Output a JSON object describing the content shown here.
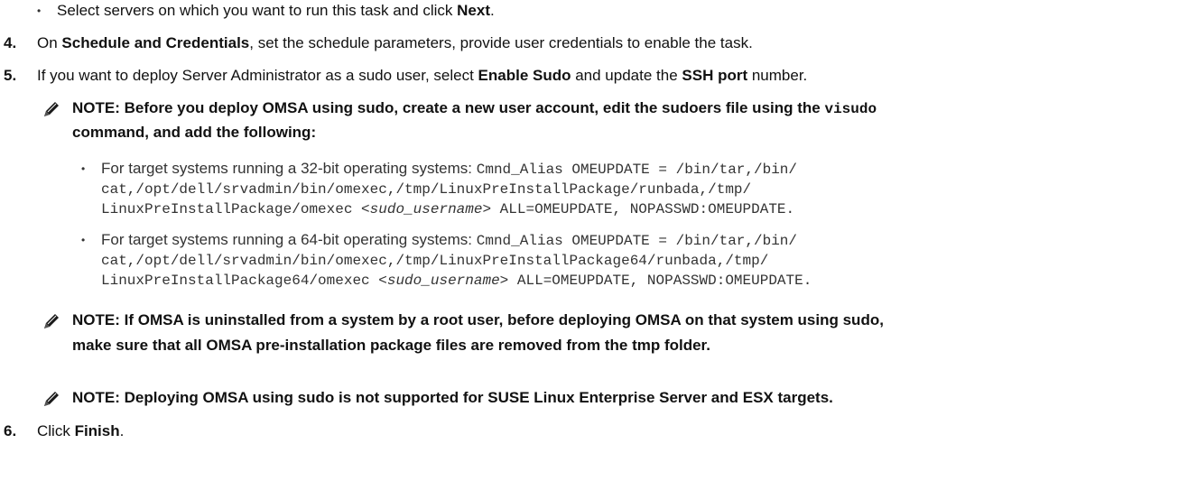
{
  "step_prev_bullet": {
    "text": "Select servers on which you want to run this task and click ",
    "bold": "Next",
    "end": "."
  },
  "step4": {
    "number": "4.",
    "pre": "On ",
    "bold": "Schedule and Credentials",
    "post": ", set the schedule parameters, provide user credentials to enable the task."
  },
  "step5": {
    "number": "5.",
    "pre": "If you want to deploy Server Administrator as a sudo user, select ",
    "bold1": "Enable Sudo",
    "mid": " and update the ",
    "bold2": "SSH port",
    "post": " number."
  },
  "note1": {
    "line1_pre": "NOTE: Before you deploy OMSA using sudo, create a new user account, edit the sudoers file using the ",
    "line1_code": "visudo",
    "line2": "command, and add the following:",
    "bullets": [
      {
        "lead": "For target systems running a 32-bit operating systems: ",
        "code1": "Cmnd_Alias OMEUPDATE = /bin/tar,/bin/",
        "code2": "cat,/opt/dell/srvadmin/bin/omexec,/tmp/LinuxPreInstallPackage/runbada,/tmp/",
        "code3_pre": "LinuxPreInstallPackage/omexec ",
        "code3_var": "<sudo_username>",
        "code3_post": " ALL=OMEUPDATE, NOPASSWD:OMEUPDATE."
      },
      {
        "lead": "For target systems running a 64-bit operating systems: ",
        "code1": "Cmnd_Alias OMEUPDATE = /bin/tar,/bin/",
        "code2": "cat,/opt/dell/srvadmin/bin/omexec,/tmp/LinuxPreInstallPackage64/runbada,/tmp/",
        "code3_pre": "LinuxPreInstallPackage64/omexec ",
        "code3_var": "<sudo_username>",
        "code3_post": " ALL=OMEUPDATE, NOPASSWD:OMEUPDATE."
      }
    ]
  },
  "note2": {
    "line1": "NOTE: If OMSA is uninstalled from a system by a root user, before deploying OMSA on that system using sudo,",
    "line2": "make sure that all OMSA pre-installation package files are removed from the tmp folder."
  },
  "note3": {
    "line1": "NOTE: Deploying OMSA using sudo is not supported for SUSE Linux Enterprise Server and ESX targets."
  },
  "step6": {
    "number": "6.",
    "pre": "Click ",
    "bold": "Finish",
    "end": "."
  },
  "colors": {
    "text": "#111111",
    "muted": "#333333"
  },
  "icons": {
    "note": "pencil-note-icon"
  }
}
